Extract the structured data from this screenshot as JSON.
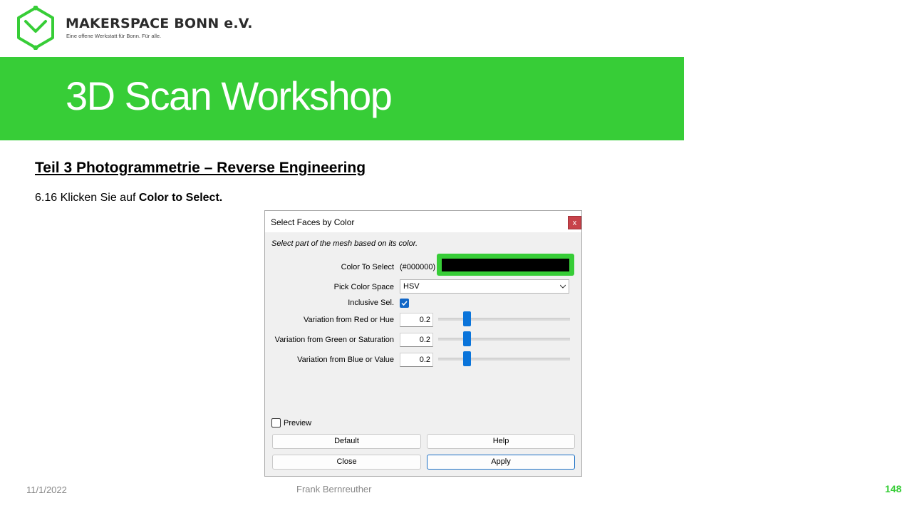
{
  "brand": {
    "name": "MAKERSPACE BONN e.V.",
    "tagline": "Eine offene Werkstatt für Bonn. Für alle.",
    "color": "#37cd37"
  },
  "banner": {
    "title": "3D Scan Workshop"
  },
  "section": {
    "heading": "Teil 3  Photogrammetrie  – Reverse Engineering"
  },
  "instruction": {
    "prefix": "6.16 Klicken Sie auf ",
    "bold": "Color to Select",
    "suffix": "."
  },
  "dialog": {
    "title": "Select Faces by Color",
    "close_label": "x",
    "description": "Select part of the mesh based on its color.",
    "color_to_select_label": "Color To Select",
    "color_hex": "(#000000)",
    "color_value": "#000000",
    "pick_color_space_label": "Pick Color Space",
    "pick_color_space_value": "HSV",
    "inclusive_label": "Inclusive Sel.",
    "inclusive_checked": true,
    "variations": [
      {
        "label": "Variation from Red or Hue",
        "value": "0.2"
      },
      {
        "label": "Variation from Green or Saturation",
        "value": "0.2"
      },
      {
        "label": "Variation from Blue or Value",
        "value": "0.2"
      }
    ],
    "preview_label": "Preview",
    "preview_checked": false,
    "buttons": {
      "default": "Default",
      "help": "Help",
      "close": "Close",
      "apply": "Apply"
    }
  },
  "footer": {
    "date": "11/1/2022",
    "author": "Frank Bernreuther",
    "page": "148"
  }
}
